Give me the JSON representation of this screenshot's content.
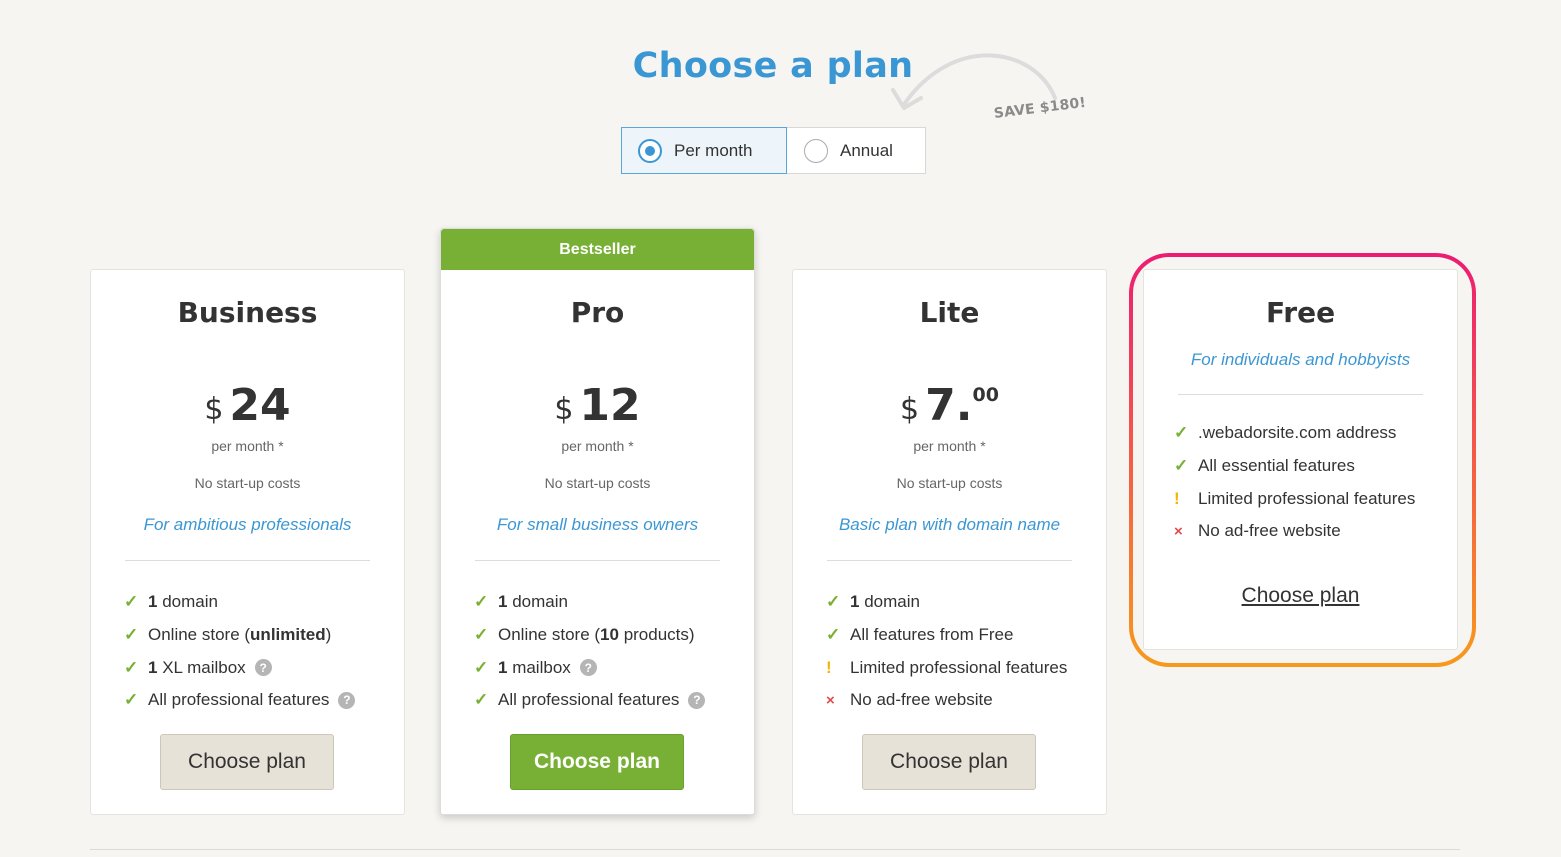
{
  "header": {
    "title": "Choose a plan",
    "save_note": "SAVE $180!"
  },
  "billing_toggle": {
    "options": [
      {
        "label": "Per month",
        "selected": true
      },
      {
        "label": "Annual",
        "selected": false
      }
    ]
  },
  "plans": [
    {
      "name": "Business",
      "currency": "$",
      "amount": "24",
      "per_month": "per month *",
      "startup": "No start-up costs",
      "tagline": "For ambitious professionals",
      "features": [
        {
          "mark": "check",
          "bold": "1",
          "text": " domain",
          "help": false
        },
        {
          "mark": "check",
          "pre": "Online store (",
          "bold": "unlimited",
          "text": ")",
          "help": false
        },
        {
          "mark": "check",
          "bold": "1",
          "text": " XL mailbox",
          "help": true
        },
        {
          "mark": "check",
          "text": "All professional features",
          "help": true
        }
      ],
      "button": "Choose plan"
    },
    {
      "name": "Pro",
      "badge": "Bestseller",
      "currency": "$",
      "amount": "12",
      "per_month": "per month *",
      "startup": "No start-up costs",
      "tagline": "For small business owners",
      "features": [
        {
          "mark": "check",
          "bold": "1",
          "text": " domain",
          "help": false
        },
        {
          "mark": "check",
          "pre": "Online store (",
          "bold": "10",
          "text": " products)",
          "help": false
        },
        {
          "mark": "check",
          "bold": "1",
          "text": " mailbox",
          "help": true
        },
        {
          "mark": "check",
          "text": "All professional features",
          "help": true
        }
      ],
      "button": "Choose plan"
    },
    {
      "name": "Lite",
      "currency": "$",
      "amount": "7.",
      "cents": "00",
      "per_month": "per month *",
      "startup": "No start-up costs",
      "tagline": "Basic plan with domain name",
      "features": [
        {
          "mark": "check",
          "bold": "1",
          "text": " domain",
          "help": false
        },
        {
          "mark": "check",
          "text": "All features from Free",
          "help": false
        },
        {
          "mark": "warn",
          "text": "Limited professional features",
          "help": false
        },
        {
          "mark": "cross",
          "text": "No ad-free website",
          "help": false
        }
      ],
      "button": "Choose plan"
    },
    {
      "name": "Free",
      "tagline": "For individuals and hobbyists",
      "features": [
        {
          "mark": "check",
          "text": ".webadorsite.com address"
        },
        {
          "mark": "check",
          "text": "All essential features"
        },
        {
          "mark": "warn",
          "text": "Limited professional features"
        },
        {
          "mark": "cross",
          "text": "No ad-free website"
        }
      ],
      "button": "Choose plan"
    }
  ],
  "glyphs": {
    "check": "✓",
    "warn": "!",
    "cross": "×",
    "help": "?"
  },
  "colors": {
    "accent_blue": "#3b97d3",
    "brand_green": "#77b034",
    "highlight_start": "#ec1c72",
    "highlight_end": "#f79a1c"
  }
}
